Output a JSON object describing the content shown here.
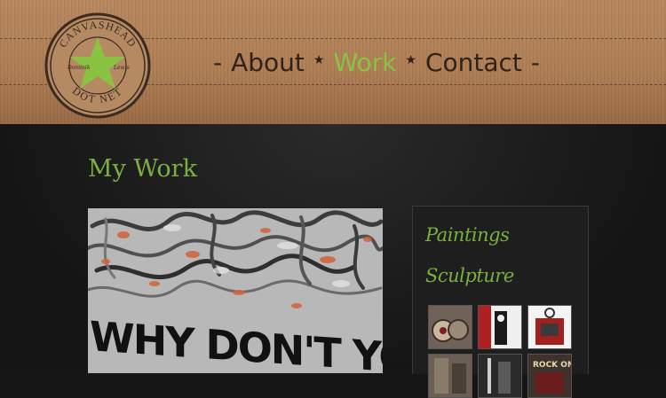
{
  "logo": {
    "top_text": "CANVASHEAD",
    "bottom_text": "DOT NET",
    "left_script": "Dominik",
    "right_script": "Lewis",
    "colors": {
      "badge": "#b58a63",
      "ring": "#3a2a20",
      "star": "#8ac241"
    }
  },
  "nav": {
    "items": [
      {
        "label": "About",
        "active": false
      },
      {
        "label": "Work",
        "active": true
      },
      {
        "label": "Contact",
        "active": false
      }
    ],
    "dash": "-",
    "separator": "★"
  },
  "main": {
    "title": "My Work",
    "painting_text": "WHY DON'T YOU JUST"
  },
  "sidebar": {
    "links": [
      "Paintings",
      "Sculpture"
    ],
    "thumbnails": [
      "sculpture-thumb-1",
      "sculpture-thumb-2",
      "sculpture-thumb-3",
      "sculpture-thumb-4",
      "sculpture-thumb-5",
      "sculpture-thumb-6"
    ],
    "thumb_text": "ROCK ON"
  },
  "colors": {
    "accent": "#7ab040",
    "nav_text": "#2e221a",
    "background": "#161616"
  }
}
